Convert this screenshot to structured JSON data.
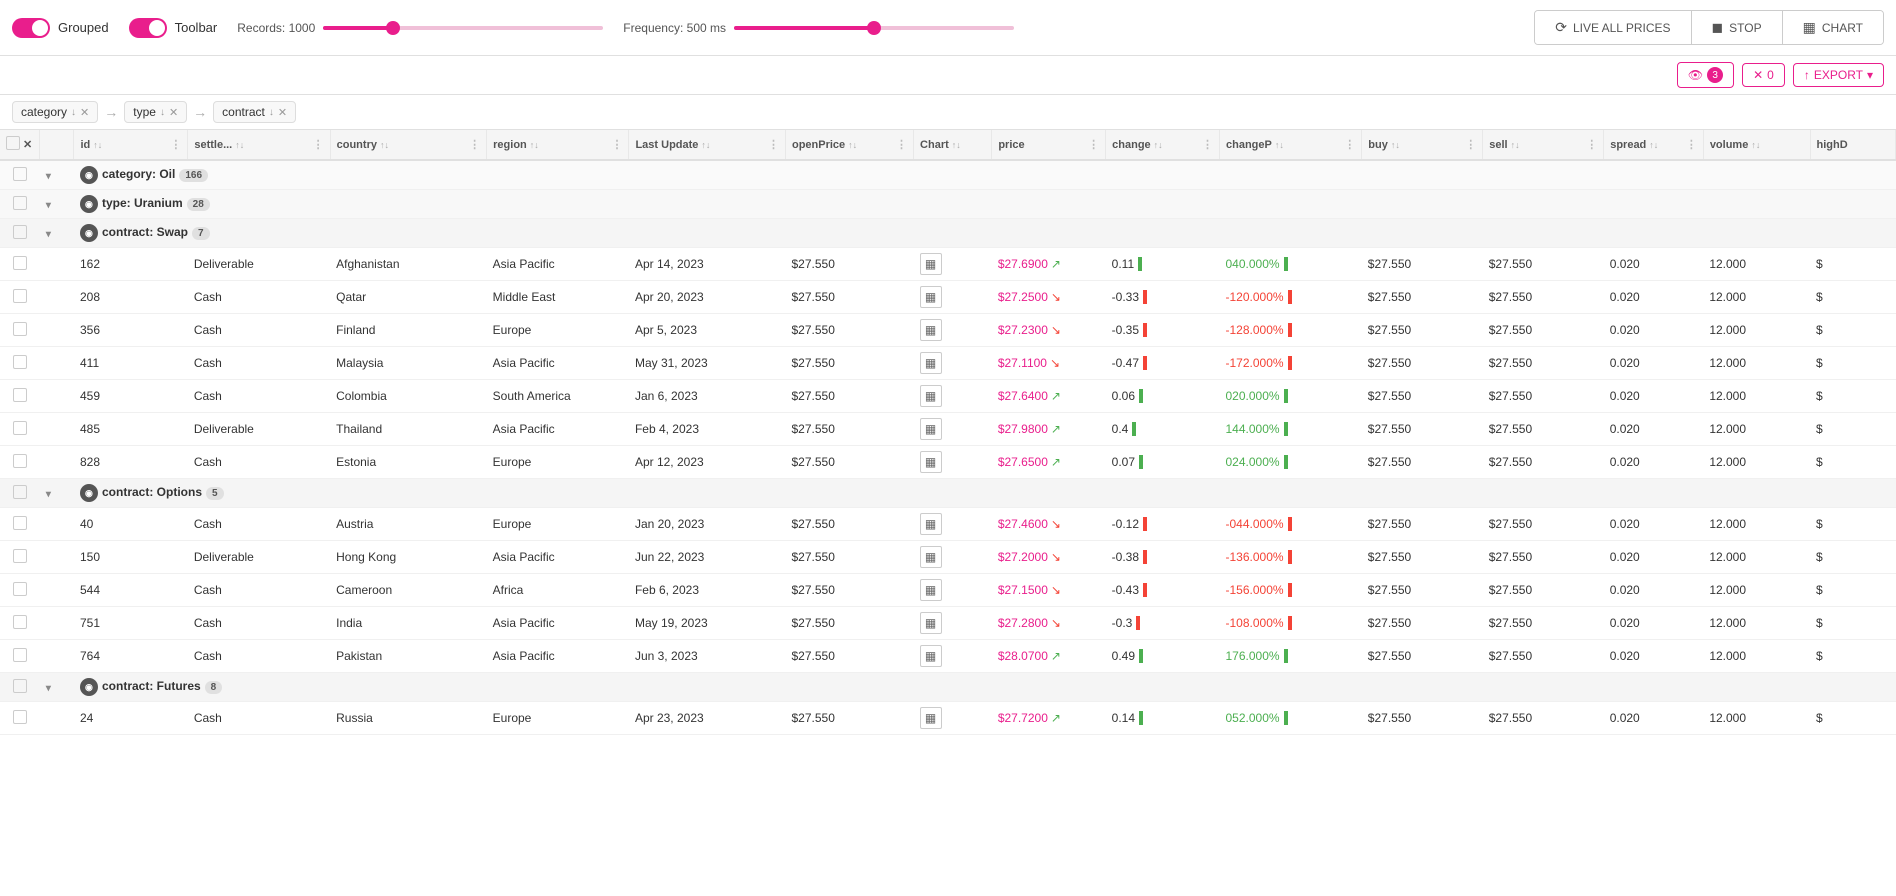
{
  "toolbar": {
    "grouped_label": "Grouped",
    "toolbar_label": "Toolbar",
    "records_label": "Records: 1000",
    "frequency_label": "Frequency: 500 ms",
    "records_value": 1000,
    "frequency_value": 500,
    "live_btn": "LIVE ALL PRICES",
    "stop_btn": "STOP",
    "chart_btn": "CHART"
  },
  "filters": {
    "filter_count": "3",
    "cross_count": "0",
    "export_label": "EXPORT",
    "tags": [
      {
        "field": "category",
        "dir": "↓",
        "x": true
      },
      {
        "arrow": "→"
      },
      {
        "field": "type",
        "dir": "↓",
        "x": true
      },
      {
        "arrow": "→"
      },
      {
        "field": "contract",
        "dir": "↓",
        "x": true
      }
    ]
  },
  "columns": [
    {
      "key": "id",
      "label": "id"
    },
    {
      "key": "settle",
      "label": "settle..."
    },
    {
      "key": "country",
      "label": "country"
    },
    {
      "key": "region",
      "label": "region"
    },
    {
      "key": "lastUpdate",
      "label": "Last Update"
    },
    {
      "key": "openPrice",
      "label": "openPrice"
    },
    {
      "key": "chart",
      "label": "Chart"
    },
    {
      "key": "price",
      "label": "price"
    },
    {
      "key": "change",
      "label": "change"
    },
    {
      "key": "changeP",
      "label": "changeP"
    },
    {
      "key": "buy",
      "label": "buy"
    },
    {
      "key": "sell",
      "label": "sell"
    },
    {
      "key": "spread",
      "label": "spread"
    },
    {
      "key": "volume",
      "label": "volume"
    },
    {
      "key": "highD",
      "label": "highD"
    }
  ],
  "groups": [
    {
      "level": 1,
      "label": "category: Oil",
      "count": 166,
      "expanded": true,
      "children": [
        {
          "level": 2,
          "label": "type: Uranium",
          "count": 28,
          "expanded": true,
          "children": [
            {
              "level": 3,
              "label": "contract: Swap",
              "count": 7,
              "expanded": true,
              "rows": [
                {
                  "id": "162",
                  "settle": "Deliverable",
                  "country": "Afghanistan",
                  "region": "Asia Pacific",
                  "lastUpdate": "Apr 14, 2023",
                  "openPrice": "$27.550",
                  "price": "$27.6900",
                  "priceDir": "up",
                  "change": "0.11",
                  "changeSign": "pos",
                  "changeP": "040.000%",
                  "changePSign": "pos",
                  "buy": "$27.550",
                  "sell": "$27.550",
                  "spread": "0.020",
                  "volume": "12.000"
                },
                {
                  "id": "208",
                  "settle": "Cash",
                  "country": "Qatar",
                  "region": "Middle East",
                  "lastUpdate": "Apr 20, 2023",
                  "openPrice": "$27.550",
                  "price": "$27.2500",
                  "priceDir": "down",
                  "change": "-0.33",
                  "changeSign": "neg",
                  "changeP": "-120.000%",
                  "changePSign": "neg",
                  "buy": "$27.550",
                  "sell": "$27.550",
                  "spread": "0.020",
                  "volume": "12.000"
                },
                {
                  "id": "356",
                  "settle": "Cash",
                  "country": "Finland",
                  "region": "Europe",
                  "lastUpdate": "Apr 5, 2023",
                  "openPrice": "$27.550",
                  "price": "$27.2300",
                  "priceDir": "down",
                  "change": "-0.35",
                  "changeSign": "neg",
                  "changeP": "-128.000%",
                  "changePSign": "neg",
                  "buy": "$27.550",
                  "sell": "$27.550",
                  "spread": "0.020",
                  "volume": "12.000"
                },
                {
                  "id": "411",
                  "settle": "Cash",
                  "country": "Malaysia",
                  "region": "Asia Pacific",
                  "lastUpdate": "May 31, 2023",
                  "openPrice": "$27.550",
                  "price": "$27.1100",
                  "priceDir": "down",
                  "change": "-0.47",
                  "changeSign": "neg",
                  "changeP": "-172.000%",
                  "changePSign": "neg",
                  "buy": "$27.550",
                  "sell": "$27.550",
                  "spread": "0.020",
                  "volume": "12.000"
                },
                {
                  "id": "459",
                  "settle": "Cash",
                  "country": "Colombia",
                  "region": "South America",
                  "lastUpdate": "Jan 6, 2023",
                  "openPrice": "$27.550",
                  "price": "$27.6400",
                  "priceDir": "up",
                  "change": "0.06",
                  "changeSign": "pos",
                  "changeP": "020.000%",
                  "changePSign": "pos",
                  "buy": "$27.550",
                  "sell": "$27.550",
                  "spread": "0.020",
                  "volume": "12.000"
                },
                {
                  "id": "485",
                  "settle": "Deliverable",
                  "country": "Thailand",
                  "region": "Asia Pacific",
                  "lastUpdate": "Feb 4, 2023",
                  "openPrice": "$27.550",
                  "price": "$27.9800",
                  "priceDir": "up",
                  "change": "0.4",
                  "changeSign": "pos",
                  "changeP": "144.000%",
                  "changePSign": "pos",
                  "buy": "$27.550",
                  "sell": "$27.550",
                  "spread": "0.020",
                  "volume": "12.000"
                },
                {
                  "id": "828",
                  "settle": "Cash",
                  "country": "Estonia",
                  "region": "Europe",
                  "lastUpdate": "Apr 12, 2023",
                  "openPrice": "$27.550",
                  "price": "$27.6500",
                  "priceDir": "up",
                  "change": "0.07",
                  "changeSign": "pos",
                  "changeP": "024.000%",
                  "changePSign": "pos",
                  "buy": "$27.550",
                  "sell": "$27.550",
                  "spread": "0.020",
                  "volume": "12.000"
                }
              ]
            },
            {
              "level": 3,
              "label": "contract: Options",
              "count": 5,
              "expanded": true,
              "rows": [
                {
                  "id": "40",
                  "settle": "Cash",
                  "country": "Austria",
                  "region": "Europe",
                  "lastUpdate": "Jan 20, 2023",
                  "openPrice": "$27.550",
                  "price": "$27.4600",
                  "priceDir": "down",
                  "change": "-0.12",
                  "changeSign": "neg",
                  "changeP": "-044.000%",
                  "changePSign": "neg",
                  "buy": "$27.550",
                  "sell": "$27.550",
                  "spread": "0.020",
                  "volume": "12.000"
                },
                {
                  "id": "150",
                  "settle": "Deliverable",
                  "country": "Hong Kong",
                  "region": "Asia Pacific",
                  "lastUpdate": "Jun 22, 2023",
                  "openPrice": "$27.550",
                  "price": "$27.2000",
                  "priceDir": "down",
                  "change": "-0.38",
                  "changeSign": "neg",
                  "changeP": "-136.000%",
                  "changePSign": "neg",
                  "buy": "$27.550",
                  "sell": "$27.550",
                  "spread": "0.020",
                  "volume": "12.000"
                },
                {
                  "id": "544",
                  "settle": "Cash",
                  "country": "Cameroon",
                  "region": "Africa",
                  "lastUpdate": "Feb 6, 2023",
                  "openPrice": "$27.550",
                  "price": "$27.1500",
                  "priceDir": "down",
                  "change": "-0.43",
                  "changeSign": "neg",
                  "changeP": "-156.000%",
                  "changePSign": "neg",
                  "buy": "$27.550",
                  "sell": "$27.550",
                  "spread": "0.020",
                  "volume": "12.000"
                },
                {
                  "id": "751",
                  "settle": "Cash",
                  "country": "India",
                  "region": "Asia Pacific",
                  "lastUpdate": "May 19, 2023",
                  "openPrice": "$27.550",
                  "price": "$27.2800",
                  "priceDir": "down",
                  "change": "-0.3",
                  "changeSign": "neg",
                  "changeP": "-108.000%",
                  "changePSign": "neg",
                  "buy": "$27.550",
                  "sell": "$27.550",
                  "spread": "0.020",
                  "volume": "12.000"
                },
                {
                  "id": "764",
                  "settle": "Cash",
                  "country": "Pakistan",
                  "region": "Asia Pacific",
                  "lastUpdate": "Jun 3, 2023",
                  "openPrice": "$27.550",
                  "price": "$28.0700",
                  "priceDir": "up",
                  "change": "0.49",
                  "changeSign": "pos",
                  "changeP": "176.000%",
                  "changePSign": "pos",
                  "buy": "$27.550",
                  "sell": "$27.550",
                  "spread": "0.020",
                  "volume": "12.000"
                }
              ]
            },
            {
              "level": 3,
              "label": "contract: Futures",
              "count": 8,
              "expanded": true,
              "rows": [
                {
                  "id": "24",
                  "settle": "Cash",
                  "country": "Russia",
                  "region": "Europe",
                  "lastUpdate": "Apr 23, 2023",
                  "openPrice": "$27.550",
                  "price": "$27.7200",
                  "priceDir": "up",
                  "change": "0.14",
                  "changeSign": "pos",
                  "changeP": "052.000%",
                  "changePSign": "pos",
                  "buy": "$27.550",
                  "sell": "$27.550",
                  "spread": "0.020",
                  "volume": "12.000"
                }
              ]
            }
          ]
        }
      ]
    }
  ]
}
